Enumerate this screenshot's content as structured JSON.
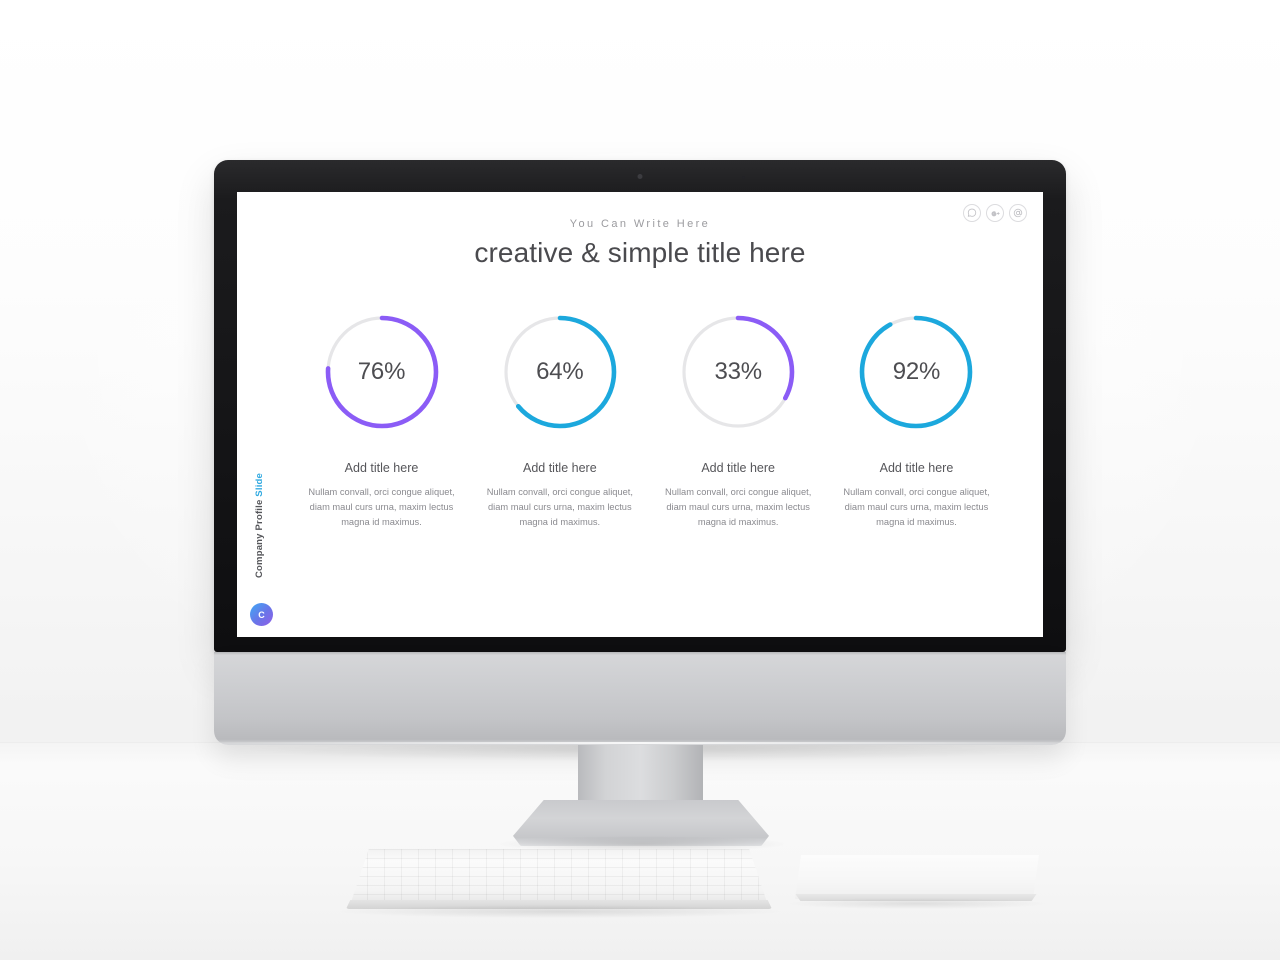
{
  "slide": {
    "eyebrow": "You Can Write Here",
    "title": "creative & simple title here",
    "sidebar": {
      "label_main": "Company Profile ",
      "label_accent": "Slide",
      "badge_letter": "C"
    },
    "socials": [
      {
        "name": "whatsapp-icon",
        "label": "WhatsApp"
      },
      {
        "name": "google-plus-icon",
        "label": "Google Plus"
      },
      {
        "name": "at-mail-icon",
        "label": "Email"
      }
    ]
  },
  "colors": {
    "purple": "#8B5CF6",
    "blue": "#1CA8DD",
    "track": "#E6E6E8",
    "title_text": "#4a4a4e",
    "body_text": "#8a8a8f",
    "accent_blue": "#2ea8e0"
  },
  "chart_data": {
    "type": "pie",
    "title": "creative & simple title here",
    "subtitle": "You Can Write Here",
    "categories": [
      "Add title here",
      "Add title here",
      "Add title here",
      "Add title here"
    ],
    "values": [
      76,
      64,
      33,
      92
    ],
    "value_labels": [
      "76%",
      "64%",
      "33%",
      "92%"
    ],
    "colors": [
      "#8B5CF6",
      "#1CA8DD",
      "#8B5CF6",
      "#1CA8DD"
    ],
    "ylim": [
      0,
      100
    ],
    "grid": false,
    "legend": "none",
    "style": "donut-gauge",
    "start_angle_deg": -90,
    "direction": "clockwise"
  },
  "columns": [
    {
      "value": 76,
      "value_label": "76%",
      "color": "#8B5CF6",
      "title": "Add title here",
      "body": "Nullam convall, orci congue aliquet, diam maul curs urna, maxim lectus magna id maximus."
    },
    {
      "value": 64,
      "value_label": "64%",
      "color": "#1CA8DD",
      "title": "Add title here",
      "body": "Nullam convall, orci congue aliquet, diam maul curs urna, maxim lectus magna id maximus."
    },
    {
      "value": 33,
      "value_label": "33%",
      "color": "#8B5CF6",
      "title": "Add title here",
      "body": "Nullam convall, orci congue aliquet, diam maul curs urna, maxim lectus magna id maximus."
    },
    {
      "value": 92,
      "value_label": "92%",
      "color": "#1CA8DD",
      "title": "Add title here",
      "body": "Nullam convall, orci congue aliquet, diam maul curs urna, maxim lectus magna id maximus."
    }
  ]
}
